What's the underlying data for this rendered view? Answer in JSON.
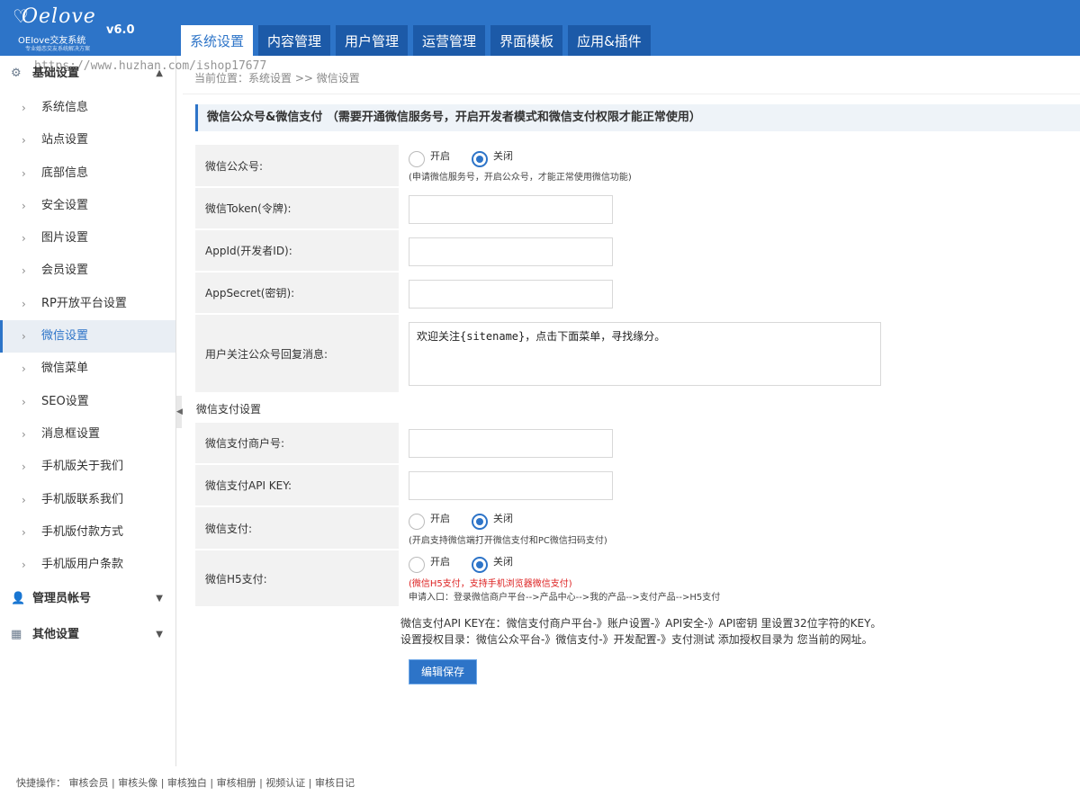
{
  "brand": {
    "script": "Oelove",
    "heart": "♡",
    "subtitle": "OEIove交友系统",
    "tagline": "专业婚恋交友系统解决方案",
    "version": "v6.0"
  },
  "tabs": [
    "系统设置",
    "内容管理",
    "用户管理",
    "运营管理",
    "界面模板",
    "应用&插件"
  ],
  "watermark": "https://www.huzhan.com/ishop17677",
  "sidebar": {
    "group1": "基础设置",
    "items": [
      "系统信息",
      "站点设置",
      "底部信息",
      "安全设置",
      "图片设置",
      "会员设置",
      "RP开放平台设置",
      "微信设置",
      "微信菜单",
      "SEO设置",
      "消息框设置",
      "手机版关于我们",
      "手机版联系我们",
      "手机版付款方式",
      "手机版用户条款"
    ],
    "group2": "管理员帐号",
    "group3": "其他设置"
  },
  "breadcrumb": "当前位置：系统设置 >> 微信设置",
  "section_title": "微信公众号&微信支付  （需要开通微信服务号，开启开发者模式和微信支付权限才能正常使用）",
  "form": {
    "wx_mp": {
      "label": "微信公众号:",
      "on": "开启",
      "off": "关闭",
      "hint": "(申请微信服务号，开启公众号，才能正常使用微信功能)"
    },
    "token": {
      "label": "微信Token(令牌):",
      "value": ""
    },
    "appid": {
      "label": "AppId(开发者ID):",
      "value": ""
    },
    "appsecret": {
      "label": "AppSecret(密钥):",
      "value": ""
    },
    "reply": {
      "label": "用户关注公众号回复消息:",
      "value": "欢迎关注{sitename}，点击下面菜单，寻找缘分。"
    },
    "pay_section": "微信支付设置",
    "mchid": {
      "label": "微信支付商户号:",
      "value": ""
    },
    "apikey": {
      "label": "微信支付API KEY:",
      "value": ""
    },
    "wxpay": {
      "label": "微信支付:",
      "on": "开启",
      "off": "关闭",
      "hint": "(开启支持微信端打开微信支付和PC微信扫码支付)"
    },
    "h5pay": {
      "label": "微信H5支付:",
      "on": "开启",
      "off": "关闭",
      "hint_red": "(微信H5支付，支持手机浏览器微信支付)",
      "hint": "申请入口：登录微信商户平台-->产品中心-->我的产品-->支付产品-->H5支付"
    },
    "note1": "微信支付API KEY在：微信支付商户平台-》账户设置-》API安全-》API密钥 里设置32位字符的KEY。",
    "note2": "设置授权目录：微信公众平台-》微信支付-》开发配置-》支付测试 添加授权目录为 您当前的网址。",
    "save": "编辑保存"
  },
  "footer": "快捷操作：  审核会员 |  审核头像 |  审核独白 |  审核相册 |  视频认证 |  审核日记"
}
